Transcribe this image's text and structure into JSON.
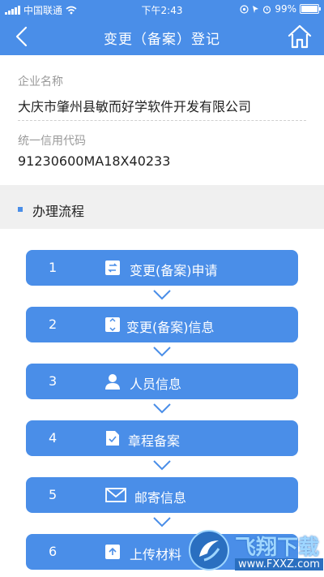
{
  "status_bar": {
    "carrier": "中国联通",
    "time": "下午2:43",
    "battery": "99%"
  },
  "nav": {
    "title": "变更（备案）登记",
    "back_icon": "chevron-left-icon",
    "home_icon": "home-icon"
  },
  "info": {
    "company_label": "企业名称",
    "company_name": "大庆市肇州县敏而好学软件开发有限公司",
    "credit_label": "统一信用代码",
    "credit_code": "91230600MA18X40233"
  },
  "section": {
    "title": "办理流程"
  },
  "steps": [
    {
      "num": "1",
      "label": "变更(备案)申请",
      "icon": "swap-document-icon"
    },
    {
      "num": "2",
      "label": "变更(备案)信息",
      "icon": "info-document-icon"
    },
    {
      "num": "3",
      "label": "人员信息",
      "icon": "person-icon"
    },
    {
      "num": "4",
      "label": "章程备案",
      "icon": "checked-document-icon"
    },
    {
      "num": "5",
      "label": "邮寄信息",
      "icon": "envelope-icon"
    },
    {
      "num": "6",
      "label": "上传材料",
      "icon": "upload-icon"
    }
  ],
  "watermark": {
    "brand": "飞翔下载",
    "url": "www.FXXZ.com"
  },
  "colors": {
    "primary": "#4a8ee8",
    "section_bg": "#f0f0f0"
  }
}
